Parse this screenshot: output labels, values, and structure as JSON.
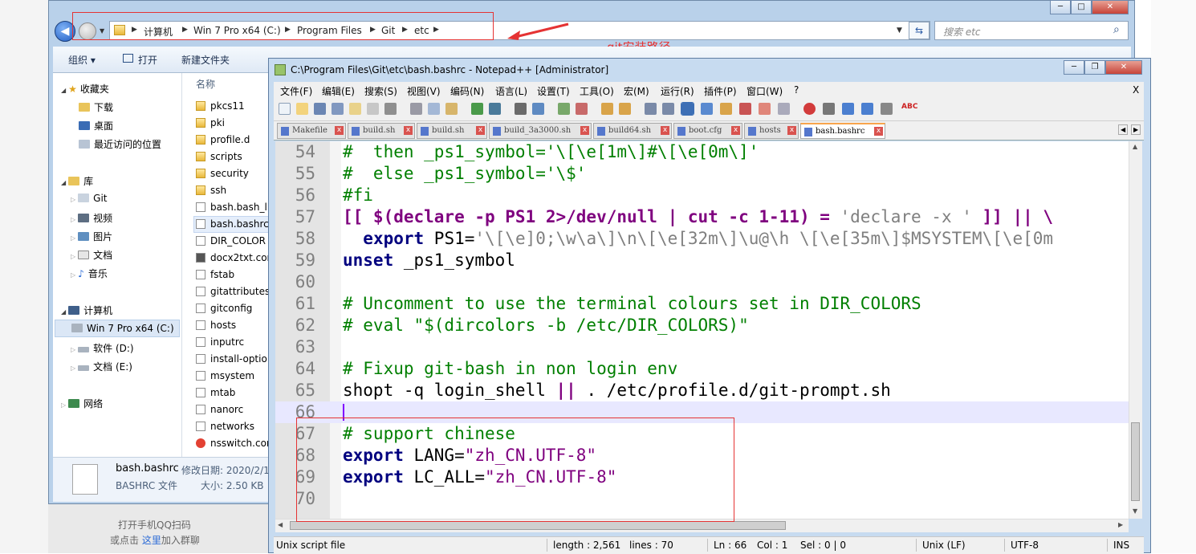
{
  "explorer": {
    "breadcrumb": [
      "计算机",
      "Win 7 Pro x64 (C:)",
      "Program Files",
      "Git",
      "etc"
    ],
    "search_placeholder": "搜索 etc",
    "toolbar": {
      "organize": "组织 ▾",
      "open": "打开",
      "new_folder": "新建文件夹"
    },
    "column_header": "名称",
    "nav": {
      "favorites": "收藏夹",
      "downloads": "下载",
      "desktop": "桌面",
      "recent": "最近访问的位置",
      "libraries": "库",
      "git": "Git",
      "videos": "视频",
      "pictures": "图片",
      "documents": "文档",
      "music": "音乐",
      "computer": "计算机",
      "drive_c": "Win 7 Pro x64 (C:)",
      "drive_d": "软件 (D:)",
      "drive_e": "文档 (E:)",
      "network": "网络"
    },
    "files": [
      "pkcs11",
      "pki",
      "profile.d",
      "scripts",
      "security",
      "ssh",
      "bash.bash_l",
      "bash.bashrc",
      "DIR_COLOR",
      "docx2txt.cor",
      "fstab",
      "gitattributes",
      "gitconfig",
      "hosts",
      "inputrc",
      "install-optio",
      "msystem",
      "mtab",
      "nanorc",
      "networks",
      "nsswitch.con"
    ],
    "details": {
      "name": "bash.bashrc",
      "modified": "修改日期: 2020/2/1",
      "type": "BASHRC 文件",
      "size": "大小: 2.50 KB"
    },
    "qq_line1": "打开手机QQ扫码",
    "qq_line2_pre": "或点击 ",
    "qq_line2_link": "这里",
    "qq_line2_post": "加入群聊"
  },
  "annotation": {
    "label": "git安装路径",
    "color": "#e53333"
  },
  "notepad": {
    "title": "C:\\Program Files\\Git\\etc\\bash.bashrc - Notepad++ [Administrator]",
    "menu": [
      "文件(F)",
      "编辑(E)",
      "搜索(S)",
      "视图(V)",
      "编码(N)",
      "语言(L)",
      "设置(T)",
      "工具(O)",
      "宏(M)",
      "运行(R)",
      "插件(P)",
      "窗口(W)",
      "?"
    ],
    "close_x": "X",
    "tabs": [
      "Makefile",
      "build.sh",
      "build.sh",
      "build_3a3000.sh",
      "build64.sh",
      "boot.cfg",
      "hosts",
      "bash.bashrc"
    ],
    "active_tab": 7,
    "lines": [
      {
        "n": "54",
        "segs": [
          {
            "c": "cm",
            "t": "#  then _ps1_symbol='\\[\\e[1m\\]#\\[\\e[0m\\]'"
          }
        ]
      },
      {
        "n": "55",
        "segs": [
          {
            "c": "cm",
            "t": "#  else _ps1_symbol='\\$'"
          }
        ]
      },
      {
        "n": "56",
        "segs": [
          {
            "c": "cm",
            "t": "#fi"
          }
        ]
      },
      {
        "n": "57",
        "segs": [
          {
            "c": "op",
            "t": "[[ $(declare -p PS1 2>/dev/null | cut -c 1-11) = "
          },
          {
            "c": "sq",
            "t": "'declare -x '"
          },
          {
            "c": "op",
            "t": " ]] || \\"
          }
        ]
      },
      {
        "n": "58",
        "segs": [
          {
            "c": "id",
            "t": "  "
          },
          {
            "c": "kw",
            "t": "export"
          },
          {
            "c": "id",
            "t": " PS1="
          },
          {
            "c": "sq",
            "t": "'\\[\\e]0;\\w\\a\\]\\n\\[\\e[32m\\]\\u@\\h \\[\\e[35m\\]$MSYSTEM\\[\\e[0m"
          }
        ]
      },
      {
        "n": "59",
        "segs": [
          {
            "c": "kw",
            "t": "unset"
          },
          {
            "c": "id",
            "t": " _ps1_symbol"
          }
        ]
      },
      {
        "n": "60",
        "segs": []
      },
      {
        "n": "61",
        "segs": [
          {
            "c": "cm",
            "t": "# Uncomment to use the terminal colours set in DIR_COLORS"
          }
        ]
      },
      {
        "n": "62",
        "segs": [
          {
            "c": "cm",
            "t": "# eval \"$(dircolors -b /etc/DIR_COLORS)\""
          }
        ]
      },
      {
        "n": "63",
        "segs": []
      },
      {
        "n": "64",
        "segs": [
          {
            "c": "cm",
            "t": "# Fixup git-bash in non login env"
          }
        ]
      },
      {
        "n": "65",
        "segs": [
          {
            "c": "id",
            "t": "shopt -q login_shell "
          },
          {
            "c": "op",
            "t": "||"
          },
          {
            "c": "id",
            "t": " . /etc/profile.d/git-prompt.sh"
          }
        ]
      },
      {
        "n": "66",
        "segs": []
      },
      {
        "n": "67",
        "segs": [
          {
            "c": "cm",
            "t": "# support chinese"
          }
        ]
      },
      {
        "n": "68",
        "segs": [
          {
            "c": "kw",
            "t": "export"
          },
          {
            "c": "id",
            "t": " LANG="
          },
          {
            "c": "str",
            "t": "\"zh_CN.UTF-8\""
          }
        ]
      },
      {
        "n": "69",
        "segs": [
          {
            "c": "kw",
            "t": "export"
          },
          {
            "c": "id",
            "t": " LC_ALL="
          },
          {
            "c": "str",
            "t": "\"zh_CN.UTF-8\""
          }
        ]
      },
      {
        "n": "70",
        "segs": []
      }
    ],
    "status": {
      "filetype": "Unix script file",
      "length": "length : 2,561",
      "lines": "lines : 70",
      "ln": "Ln : 66",
      "col": "Col : 1",
      "sel": "Sel : 0 | 0",
      "eol": "Unix (LF)",
      "enc": "UTF-8",
      "ins": "INS"
    }
  }
}
